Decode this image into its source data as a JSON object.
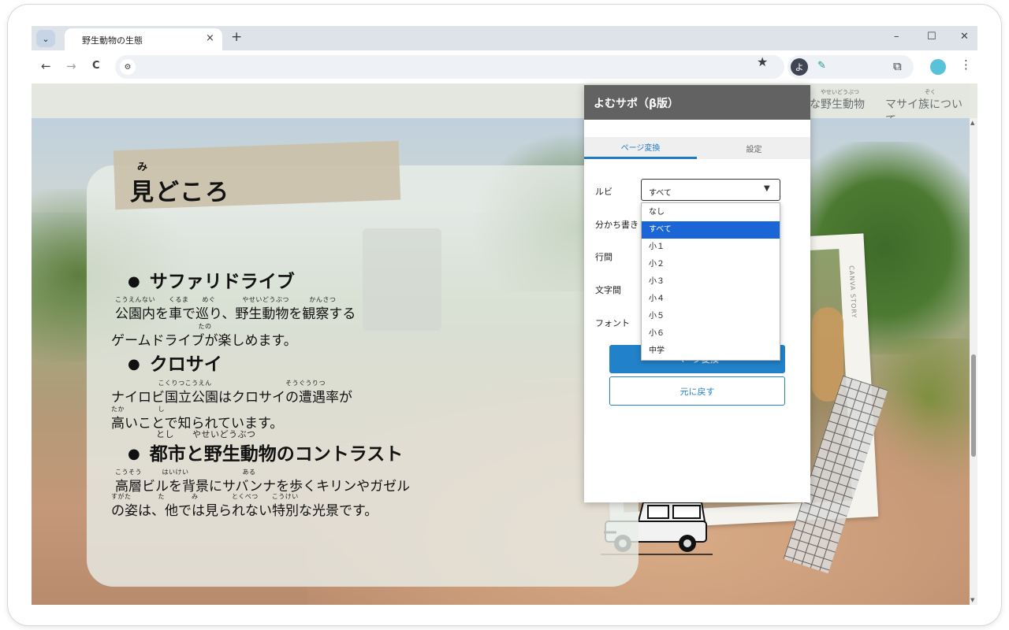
{
  "browser": {
    "tab_title": "野生動物の生態",
    "tab_close": "×",
    "new_tab": "+",
    "tab_search_icon": "chevron-down",
    "win_min": "–",
    "win_max": "☐",
    "win_close": "✕",
    "back": "←",
    "forward": "→",
    "reload": "C",
    "star": "★",
    "ext_yomu": "よ",
    "ext_pen": "✎",
    "ext_puzzle": "⧉",
    "menu": "⋮"
  },
  "site": {
    "nav": [
      {
        "label": "な野生動物",
        "ruby": "やせいどうぶつ"
      },
      {
        "label": "マサイ族について",
        "ruby": "ぞく"
      }
    ]
  },
  "content": {
    "heading": "見どころ",
    "heading_ruby": "み",
    "items": [
      {
        "title": "サファリドライブ",
        "ruby_title": "",
        "ruby1": "こうえんない　　くるま　　めぐ　　　　やせいどうぶつ　　　かんさつ",
        "line1": "公園内を車で巡り、野生動物を観察する",
        "ruby2": "　　　　　　　　　　　　　たの",
        "line2": "ゲームドライブが楽しめます。"
      },
      {
        "title": "クロサイ",
        "ruby_title": "",
        "ruby1": "　　　　　　　こくりつこうえん　　　　　　　　　　　そうぐうりつ",
        "line1": "ナイロビ国立公園はクロサイの遭遇率が",
        "ruby2": "たか　　　　　し",
        "line2": "高いことで知られています。"
      },
      {
        "title": "都市と野生動物のコントラスト",
        "ruby_title": "とし　　やせいどうぶつ",
        "ruby1": "こうそう　　　はいけい　　　　　　　　ある",
        "line1": "高層ビルを背景にサバンナを歩くキリンやガゼル",
        "ruby2": "すがた　　　　た　　　　み　　　　　とくべつ　　こうけい",
        "line2": "の姿は、他では見られない特別な光景です。"
      }
    ],
    "photo_caption": "CANVA STORY"
  },
  "popup": {
    "title": "よむサポ（β版）",
    "tabs": [
      "ページ変換",
      "設定"
    ],
    "labels": {
      "ruby": "ルビ",
      "wakachi": "分かち書き",
      "line_spacing": "行間",
      "char_spacing": "文字間",
      "font": "フォント"
    },
    "ruby_select_value": "すべて",
    "ruby_options": [
      "なし",
      "すべて",
      "小１",
      "小２",
      "小３",
      "小４",
      "小５",
      "小６",
      "中学"
    ],
    "selected_option_index": 1,
    "convert_button": "ページ変換",
    "reset_button": "元に戻す"
  }
}
